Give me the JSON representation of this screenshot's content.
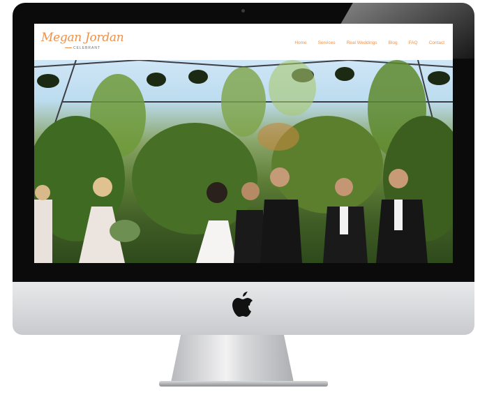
{
  "site": {
    "logo_name": "Megan Jordan",
    "logo_sub": "CELEBRANT",
    "nav": [
      "Home",
      "Services",
      "Real Weddings",
      "Blog",
      "FAQ",
      "Contact"
    ]
  },
  "colors": {
    "accent": "#f0914a",
    "bezel": "#0b0b0c",
    "chin": "#d7d8da"
  },
  "icons": {
    "brand": "apple-logo-icon"
  }
}
